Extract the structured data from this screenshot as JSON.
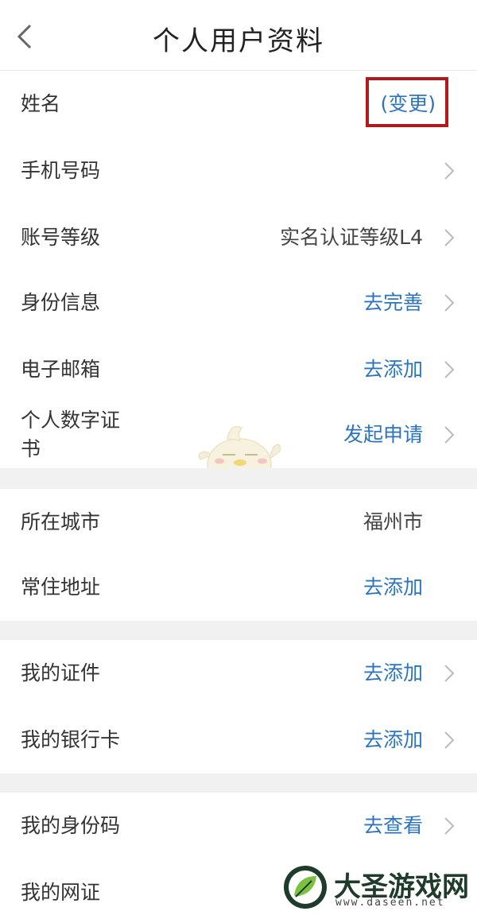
{
  "header": {
    "title": "个人用户资料",
    "back_icon": "chevron-left-icon"
  },
  "profile": {
    "name": {
      "label": "姓名",
      "action": "(变更)"
    },
    "phone": {
      "label": "手机号码"
    },
    "account_level": {
      "label": "账号等级",
      "value": "实名认证等级L4"
    },
    "identity": {
      "label": "身份信息",
      "action": "去完善"
    },
    "email": {
      "label": "电子邮箱",
      "action": "去添加"
    },
    "certificate": {
      "label_line1": "个人数字证",
      "label_line2": "书",
      "action": "发起申请"
    }
  },
  "location": {
    "city": {
      "label": "所在城市",
      "value": "福州市"
    },
    "address": {
      "label": "常住地址",
      "action": "去添加"
    }
  },
  "documents": {
    "ids": {
      "label": "我的证件",
      "action": "去添加"
    },
    "bank_cards": {
      "label": "我的银行卡",
      "action": "去添加"
    }
  },
  "codes": {
    "id_code": {
      "label": "我的身份码",
      "action": "去查看"
    },
    "net_cert": {
      "label": "我的网证"
    }
  },
  "watermark": {
    "title": "大圣游戏网",
    "url": "www.daseen.net"
  },
  "colors": {
    "link": "#2c74c0",
    "highlight": "#b3191b",
    "separator": "#f1f1f1"
  }
}
